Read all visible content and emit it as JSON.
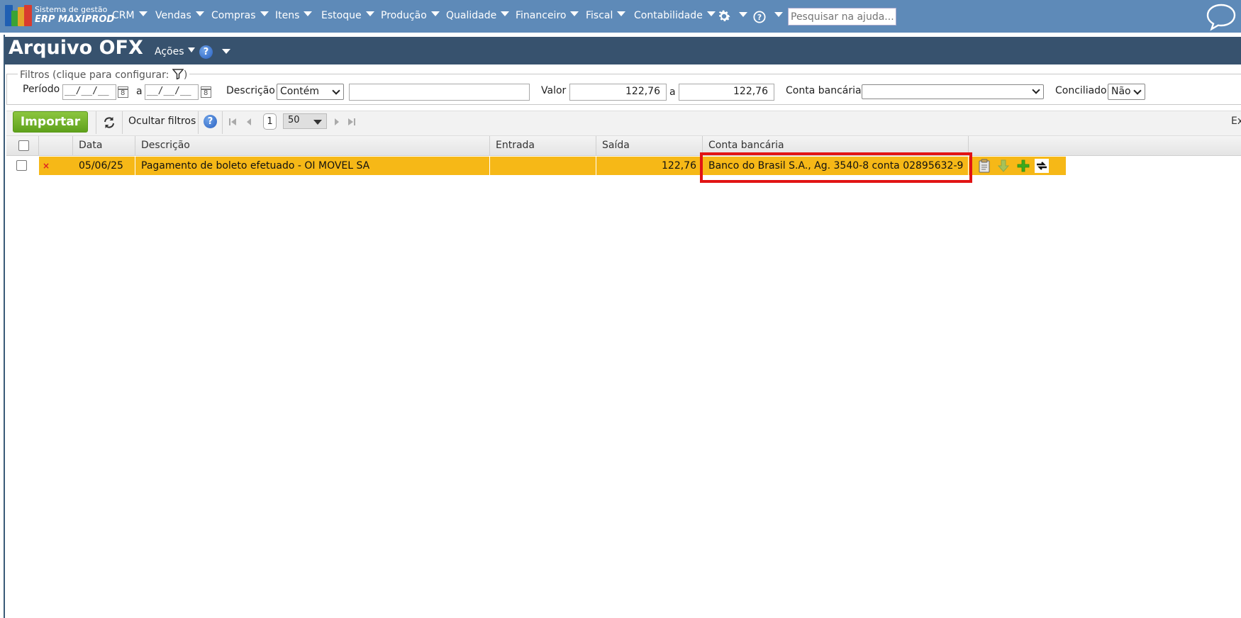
{
  "brand": {
    "line1": "Sistema de gestão",
    "line2": "ERP MAXIPROD",
    "colors": [
      "#1f5fb3",
      "#3aa335",
      "#e3a42a",
      "#d93b2e"
    ]
  },
  "nav": {
    "items": [
      "CRM",
      "Vendas",
      "Compras",
      "Itens",
      "Estoque",
      "Produção",
      "Qualidade",
      "Financeiro",
      "Fiscal",
      "Contabilidade"
    ],
    "search_placeholder": "Pesquisar na ajuda...",
    "icons": [
      "gear-icon",
      "help-icon",
      "chat-icon"
    ]
  },
  "page": {
    "title": "Arquivo OFX",
    "actions_label": "Ações",
    "help_glyph": "?"
  },
  "filters": {
    "legend": "Filtros (clique para configurar:",
    "legend_close": ")",
    "periodo_label": "Período",
    "date_from": "__/__/__",
    "range_sep": "a",
    "date_to": "__/__/__",
    "descricao_label": "Descrição",
    "descricao_mode": "Contém",
    "descricao_value": "",
    "valor_label": "Valor",
    "valor_from": "122,76",
    "valor_to": "122,76",
    "conta_label": "Conta bancária",
    "conta_value": "",
    "conciliado_label": "Conciliado",
    "conciliado_value": "Não"
  },
  "toolbar": {
    "import_label": "Importar",
    "hide_filters_label": "Ocultar filtros",
    "page": "1",
    "page_size": "50",
    "export_label": "Ex"
  },
  "grid": {
    "columns": [
      "Data",
      "Descrição",
      "Entrada",
      "Saída",
      "Conta bancária"
    ],
    "rows": [
      {
        "status": "×",
        "data": "05/06/25",
        "descricao": "Pagamento de boleto efetuado - OI MOVEL SA",
        "entrada": "",
        "saida": "122,76",
        "conta": "Banco do Brasil S.A., Ag. 3540-8 conta 02895632-9",
        "action_icons": [
          "clipboard-icon",
          "download-icon",
          "add-icon",
          "link-icon"
        ]
      }
    ],
    "row_color": "#f6b817",
    "highlight_color": "#e11414"
  }
}
